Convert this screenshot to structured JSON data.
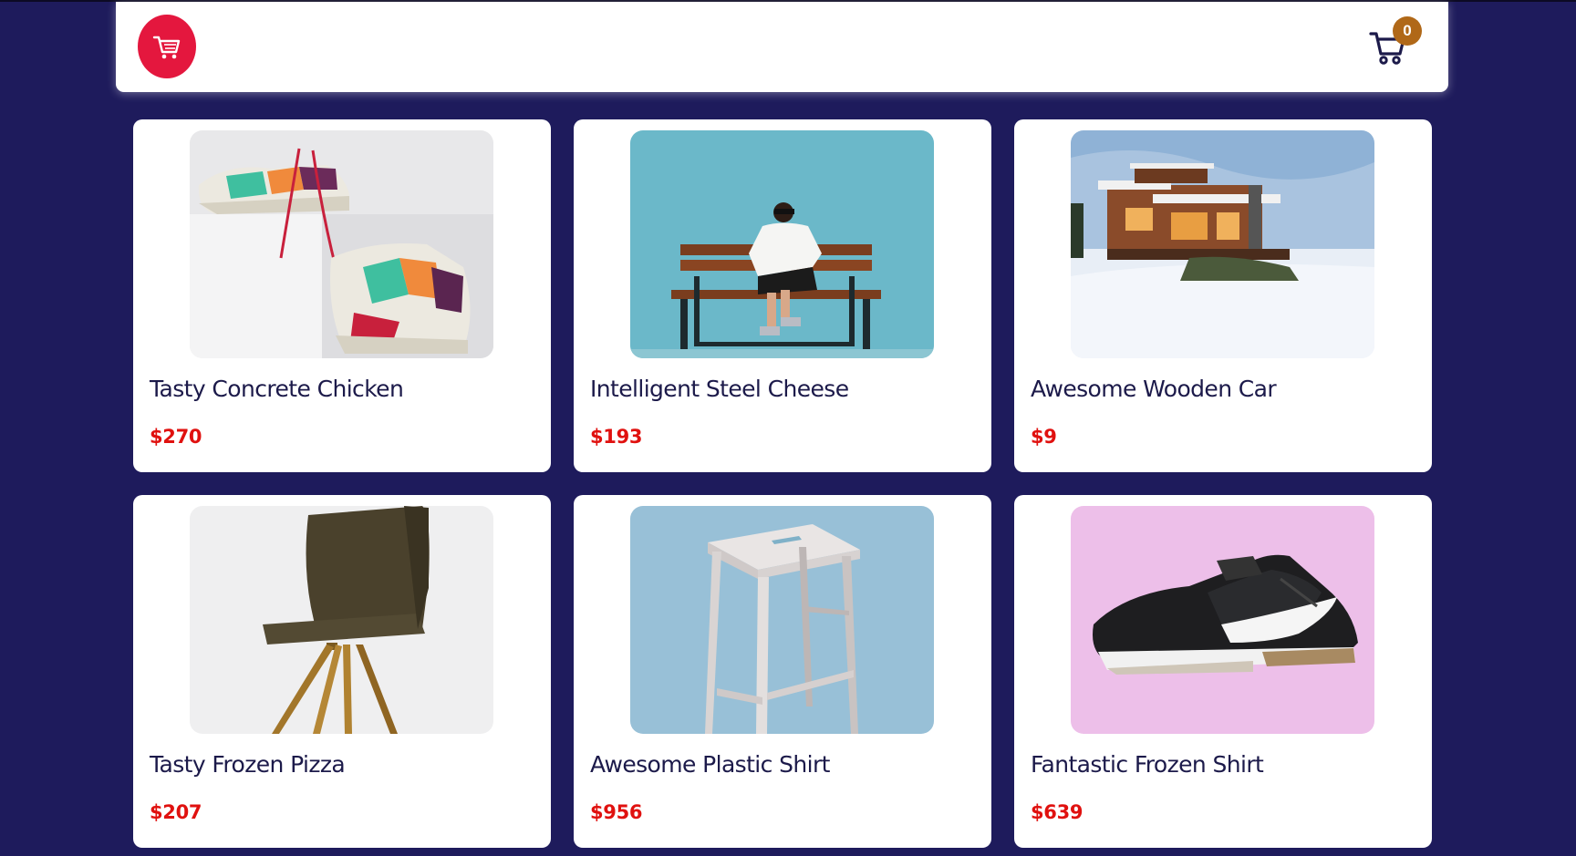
{
  "header": {
    "logo_icon": "shopping-cart-logo-icon",
    "cart_icon": "cart-icon",
    "cart_count": "0",
    "colors": {
      "logo_bg": "#e4173e",
      "badge_bg": "#b06818",
      "cart_icon": "#1c1a4a"
    }
  },
  "products": [
    {
      "title": "Tasty Concrete Chicken",
      "price": "$270",
      "image_icon": "sneakers-photo"
    },
    {
      "title": "Intelligent Steel Cheese",
      "price": "$193",
      "image_icon": "person-on-bench-photo"
    },
    {
      "title": "Awesome Wooden Car",
      "price": "$9",
      "image_icon": "snowy-house-photo"
    },
    {
      "title": "Tasty Frozen Pizza",
      "price": "$207",
      "image_icon": "chair-photo"
    },
    {
      "title": "Awesome Plastic Shirt",
      "price": "$956",
      "image_icon": "stool-photo"
    },
    {
      "title": "Fantastic Frozen Shirt",
      "price": "$639",
      "image_icon": "black-sneaker-photo"
    }
  ],
  "colors": {
    "page_bg": "#1e1b5c",
    "title_text": "#1c1a4a",
    "price_text": "#e0110f"
  }
}
